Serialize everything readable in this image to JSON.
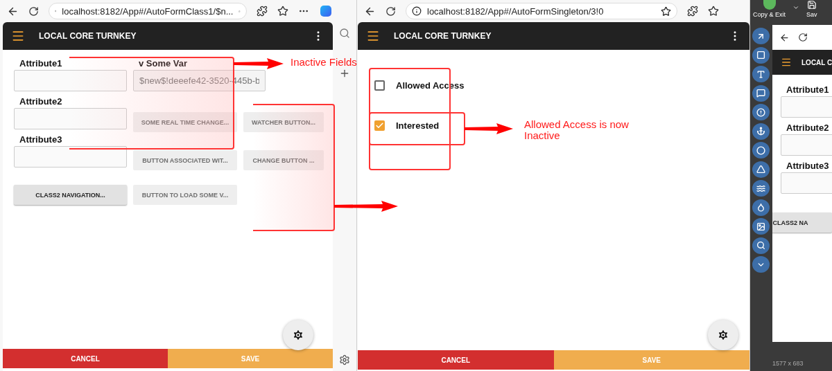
{
  "left_browser": {
    "url": "localhost:8182/App#/AutoFormClass1/$n...",
    "app_title": "LOCAL CORE TURNKEY",
    "fields": [
      {
        "label": "Attribute1"
      },
      {
        "label": "Attribute2"
      },
      {
        "label": "Attribute3"
      }
    ],
    "some_var": {
      "label": "v Some Var",
      "value": "$new$!deeefe42-3520-445b-b",
      "disabled": true
    },
    "buttons": [
      {
        "label": "SOME REAL TIME CHANGE...",
        "disabled": true
      },
      {
        "label": "WATCHER BUTTON...",
        "disabled": true
      },
      {
        "label": "BUTTON ASSOCIATED WIT...",
        "disabled": true
      },
      {
        "label": "CHANGE BUTTON ...",
        "disabled": true
      },
      {
        "label": "CLASS2 NAVIGATION...",
        "disabled": false
      },
      {
        "label": "BUTTON TO LOAD SOME V...",
        "disabled": true
      }
    ],
    "cancel": "CANCEL",
    "save": "SAVE"
  },
  "right_browser": {
    "url": "localhost:8182/App#/AutoFormSingleton/3!0",
    "app_title": "LOCAL CORE TURNKEY",
    "checkboxes": [
      {
        "label": "Allowed Access",
        "checked": false
      },
      {
        "label": "Interested",
        "checked": true
      }
    ],
    "cancel": "CANCEL",
    "save": "SAVE"
  },
  "editor": {
    "actions": [
      "Copy & Exit",
      "Sav"
    ],
    "preview": {
      "app_title": "LOCAL C",
      "fields": [
        "Attribute1",
        "Attribute2",
        "Attribute3"
      ],
      "button": "CLASS2 NA"
    },
    "status": "1577 x 683"
  },
  "annotations": [
    "Inactive Fields",
    "Allowed Access is now Inactive"
  ]
}
